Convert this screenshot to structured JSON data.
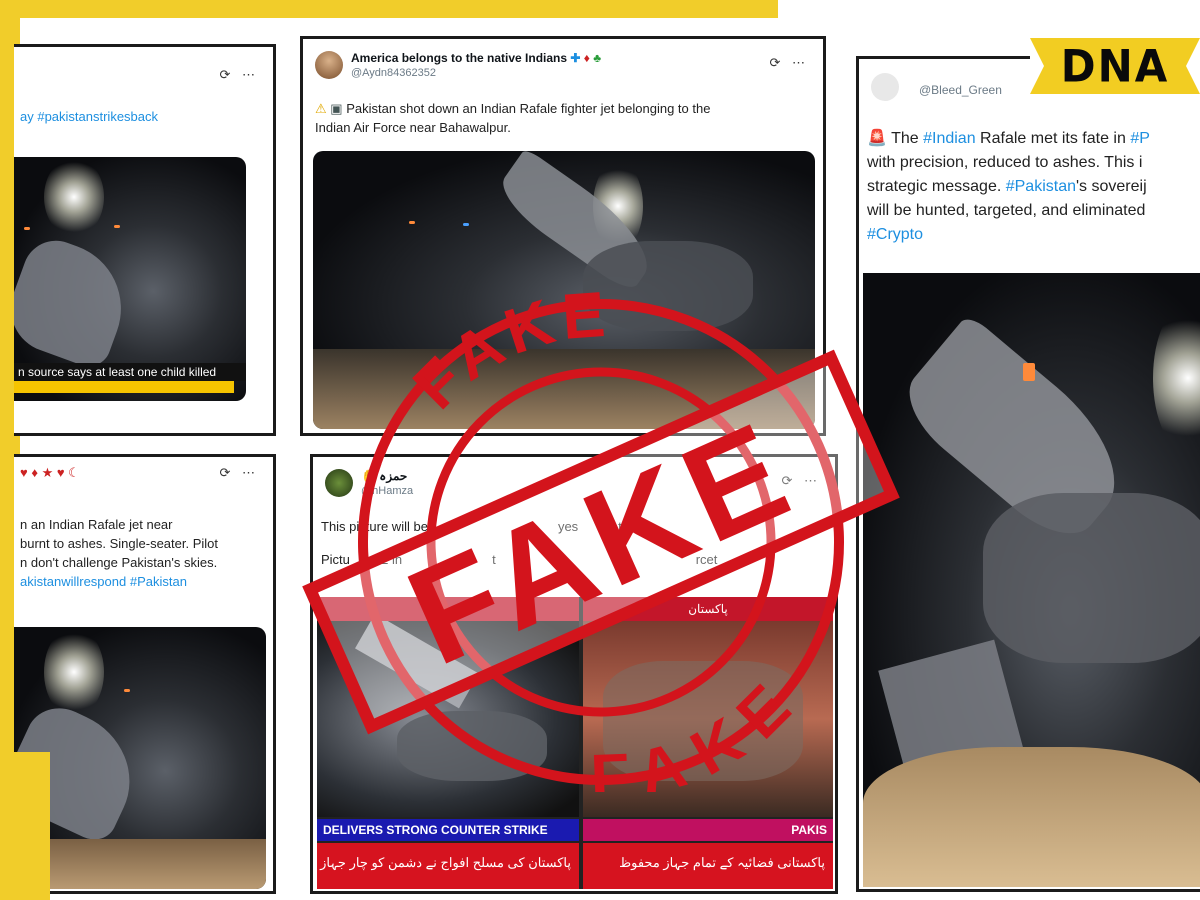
{
  "brand": {
    "logo_text": "DNA"
  },
  "card_left_top": {
    "hashtags": "ay #pakistanstrikesback",
    "caption": "n source says at least one child killed"
  },
  "card_left_bottom": {
    "emoji_line": "♥ ♦ ★ ♥ ☾",
    "text_line1": "n an Indian Rafale jet near",
    "text_line2": "burnt to ashes. Single-seater. Pilot",
    "text_line3": "n don't challenge Pakistan's skies.",
    "hashtags": "akistanwillrespond #Pakistan"
  },
  "card_center_top": {
    "user_name": "America belongs to the native Indians",
    "handle": "@Aydn84362352",
    "text_line1": "Pakistan shot down an Indian Rafale fighter jet belonging to the",
    "text_line2": "Indian Air Force near Bahawalpur."
  },
  "card_center_bottom": {
    "user_name": "حمزہ",
    "handle": "@hHamza",
    "text_line1": "This picture will be",
    "text_line1b": "yes",
    "text_line1c": "t",
    "text_line2": "Pictu",
    "text_line2b": "f 2 in",
    "text_line2c": "t",
    "text_line2d": "rcet",
    "tv_top_left": "پاکستان",
    "tv_top_right": "پاکستان",
    "tv_banner": "DELIVERS STRONG COUNTER STRIKE",
    "tv_banner_right": "PAKIS",
    "tv_urdu_left": "پاکستان کی مسلح افواج نے دشمن کو چار جہاز گرائے",
    "tv_urdu_right": "پاکستانی فضائیہ کے تمام جہاز محفوظ"
  },
  "card_right": {
    "handle": "@Bleed_Green",
    "text_line1_pre": "The ",
    "text_line1_tag1": "#Indian",
    "text_line1_mid": " Rafale met its fate in ",
    "text_line1_tag2": "#P",
    "text_line2": "with precision, reduced to ashes. This i",
    "text_line3": "strategic message. ",
    "text_line3_tag": "#Pakistan",
    "text_line3_post": "'s sovereij",
    "text_line4": "will be hunted, targeted, and eliminated",
    "text_line5_tag": "#Crypto"
  },
  "stamp": {
    "word_center": "FAKE",
    "word_top": "FAKE",
    "word_bottom": "FAKE",
    "color": "#d3141c"
  },
  "colors": {
    "accent_yellow": "#f1cd2a",
    "link_blue": "#1d8fe0",
    "stamp_red": "#d3141c"
  }
}
